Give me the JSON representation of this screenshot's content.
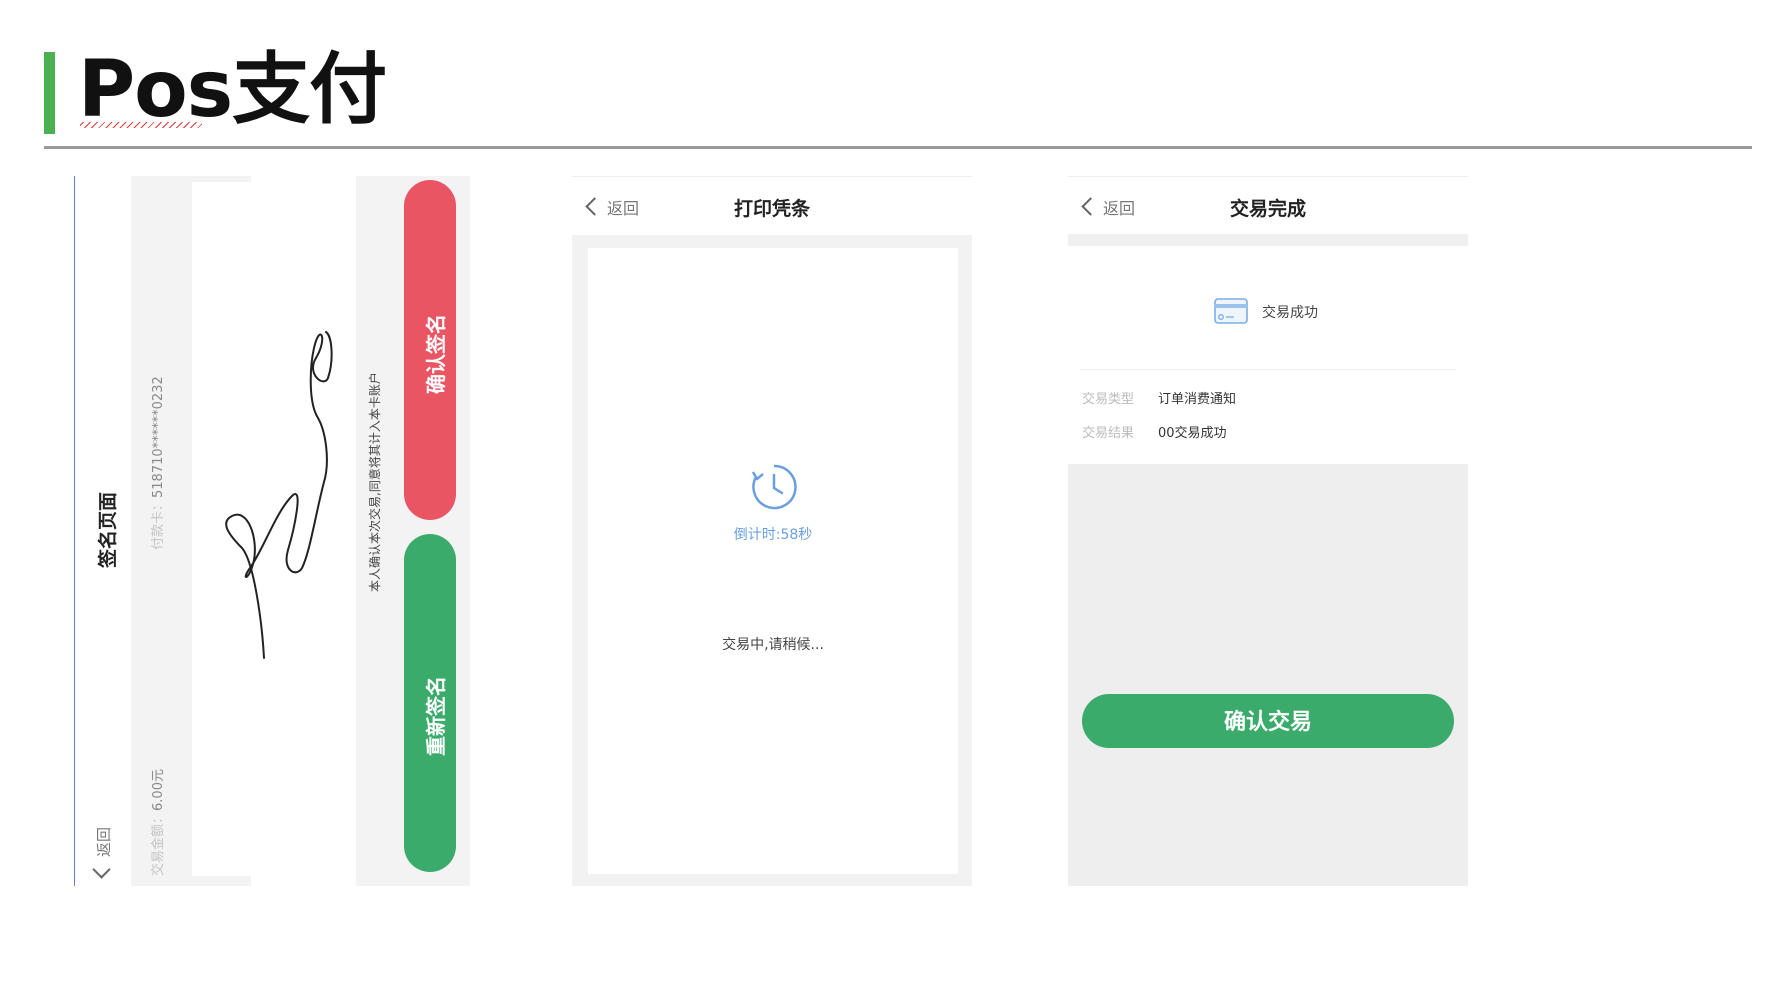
{
  "slide": {
    "title": "Pos支付"
  },
  "signature_screen": {
    "back_label": "返回",
    "page_title": "签名页面",
    "card_label": "付款卡：",
    "card_number": "518710******0232",
    "amount_label": "交易金额：",
    "amount_value": "6.00元",
    "agreement_text": "本人确认本次交易,同意将其计入本卡账户",
    "confirm_button": "确认签名",
    "resign_button": "重新签名",
    "colors": {
      "confirm": "#ea5564",
      "resign": "#3bab6b"
    }
  },
  "print_screen": {
    "back_label": "返回",
    "title": "打印凭条",
    "timer_icon": "clock-refresh-icon",
    "countdown": "倒计时:58秒",
    "status": "交易中,请稍候..."
  },
  "done_screen": {
    "back_label": "返回",
    "title": "交易完成",
    "card_icon": "credit-card-icon",
    "result_banner": "交易成功",
    "rows": [
      {
        "label": "交易类型",
        "value": "订单消费通知"
      },
      {
        "label": "交易结果",
        "value": "00交易成功"
      }
    ],
    "confirm_button": "确认交易",
    "colors": {
      "button": "#3bab6b"
    }
  },
  "accent_color": "#4caf50"
}
